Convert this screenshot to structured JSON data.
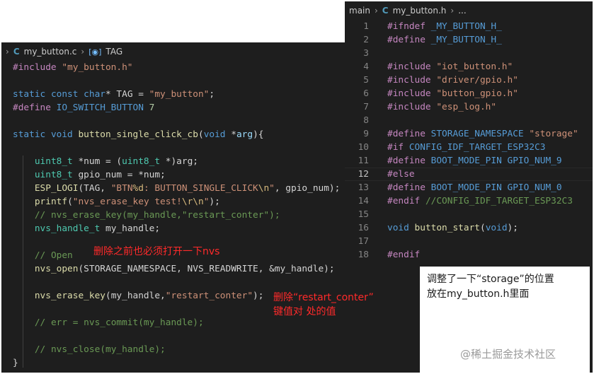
{
  "left_editor": {
    "breadcrumb": {
      "file": "my_button.c",
      "symbol": "TAG"
    },
    "lines": [
      [
        [
          "pp",
          "#include "
        ],
        [
          "str",
          "\"my_button.h\""
        ]
      ],
      [],
      [
        [
          "kw",
          "static "
        ],
        [
          "kw",
          "const "
        ],
        [
          "kw",
          "char"
        ],
        [
          "txt",
          "* TAG = "
        ],
        [
          "str",
          "\"my_button\""
        ],
        [
          "txt",
          ";"
        ]
      ],
      [
        [
          "pp",
          "#define "
        ],
        [
          "mac",
          "IO_SWITCH_BUTTON "
        ],
        [
          "num",
          "7"
        ]
      ],
      [],
      [
        [
          "kw",
          "static "
        ],
        [
          "kw",
          "void "
        ],
        [
          "fn",
          "button_single_click_cb"
        ],
        [
          "txt",
          "("
        ],
        [
          "kw",
          "void "
        ],
        [
          "txt",
          "*"
        ],
        [
          "var",
          "arg"
        ],
        [
          "txt",
          "){"
        ]
      ],
      [],
      [
        [
          "txt",
          "    "
        ],
        [
          "ty",
          "uint8_t "
        ],
        [
          "txt",
          "*num = ("
        ],
        [
          "ty",
          "uint8_t "
        ],
        [
          "txt",
          "*)arg;"
        ]
      ],
      [
        [
          "txt",
          "    "
        ],
        [
          "ty",
          "uint8_t "
        ],
        [
          "txt",
          "gpio_num = *num;"
        ]
      ],
      [
        [
          "txt",
          "    "
        ],
        [
          "fn",
          "ESP_LOGI"
        ],
        [
          "txt",
          "(TAG, "
        ],
        [
          "str",
          "\"BTN"
        ],
        [
          "fmt",
          "%d"
        ],
        [
          "str",
          ": BUTTON_SINGLE_CLICK"
        ],
        [
          "esc",
          "\\n"
        ],
        [
          "str",
          "\""
        ],
        [
          "txt",
          ", gpio_num);"
        ]
      ],
      [
        [
          "txt",
          "    "
        ],
        [
          "fn",
          "printf"
        ],
        [
          "txt",
          "("
        ],
        [
          "str",
          "\"nvs_erase_key test!"
        ],
        [
          "esc",
          "\\r\\n"
        ],
        [
          "str",
          "\""
        ],
        [
          "txt",
          ");"
        ]
      ],
      [
        [
          "txt",
          "    "
        ],
        [
          "cm",
          "// nvs_erase_key(my_handle,\"restart_conter\");"
        ]
      ],
      [
        [
          "txt",
          "    "
        ],
        [
          "ty",
          "nvs_handle_t "
        ],
        [
          "txt",
          "my_handle;"
        ]
      ],
      [],
      [
        [
          "txt",
          "    "
        ],
        [
          "cm",
          "// Open"
        ]
      ],
      [
        [
          "txt",
          "    "
        ],
        [
          "fn",
          "nvs_open"
        ],
        [
          "txt",
          "(STORAGE_NAMESPACE, NVS_READWRITE, &my_handle);"
        ]
      ],
      [],
      [
        [
          "txt",
          "    "
        ],
        [
          "fn",
          "nvs_erase_key"
        ],
        [
          "txt",
          "(my_handle,"
        ],
        [
          "str",
          "\"restart_conter\""
        ],
        [
          "txt",
          ");"
        ]
      ],
      [],
      [
        [
          "txt",
          "    "
        ],
        [
          "cm",
          "// err = nvs_commit(my_handle);"
        ]
      ],
      [],
      [
        [
          "txt",
          "    "
        ],
        [
          "cm",
          "// nvs_close(my_handle);"
        ]
      ],
      [
        [
          "txt",
          "}"
        ]
      ]
    ]
  },
  "right_editor": {
    "breadcrumb": {
      "folder": "main",
      "file": "my_button.h",
      "ellipsis": "..."
    },
    "active_line": 12,
    "lines": [
      {
        "n": "1",
        "t": [
          [
            "pp",
            "#ifndef "
          ],
          [
            "mac",
            "_MY_BUTTON_H_"
          ]
        ]
      },
      {
        "n": "2",
        "t": [
          [
            "pp",
            "#define "
          ],
          [
            "mac",
            "_MY_BUTTON_H_"
          ]
        ]
      },
      {
        "n": "3",
        "t": []
      },
      {
        "n": "4",
        "t": [
          [
            "pp",
            "#include "
          ],
          [
            "str",
            "\"iot_button.h\""
          ]
        ]
      },
      {
        "n": "5",
        "t": [
          [
            "pp",
            "#include "
          ],
          [
            "str",
            "\"driver/gpio.h\""
          ]
        ]
      },
      {
        "n": "6",
        "t": [
          [
            "pp",
            "#include "
          ],
          [
            "str",
            "\"button_gpio.h\""
          ]
        ]
      },
      {
        "n": "7",
        "t": [
          [
            "pp",
            "#include "
          ],
          [
            "str",
            "\"esp_log.h\""
          ]
        ]
      },
      {
        "n": "8",
        "t": []
      },
      {
        "n": "9",
        "t": [
          [
            "pp",
            "#define "
          ],
          [
            "mac",
            "STORAGE_NAMESPACE "
          ],
          [
            "str",
            "\"storage\""
          ]
        ]
      },
      {
        "n": "10",
        "t": [
          [
            "pp",
            "#if "
          ],
          [
            "mac",
            "CONFIG_IDF_TARGET_ESP32C3"
          ]
        ]
      },
      {
        "n": "11",
        "t": [
          [
            "pp",
            "#define "
          ],
          [
            "mac",
            "BOOT_MODE_PIN "
          ],
          [
            "mac",
            "GPIO_NUM_9"
          ]
        ]
      },
      {
        "n": "12",
        "t": [
          [
            "pp",
            "#else"
          ]
        ]
      },
      {
        "n": "13",
        "t": [
          [
            "pp",
            "#define "
          ],
          [
            "mac",
            "BOOT_MODE_PIN "
          ],
          [
            "mac",
            "GPIO_NUM_0"
          ]
        ]
      },
      {
        "n": "14",
        "t": [
          [
            "pp",
            "#endif "
          ],
          [
            "cm",
            "//CONFIG_IDF_TARGET_ESP32C3"
          ]
        ]
      },
      {
        "n": "15",
        "t": []
      },
      {
        "n": "16",
        "t": [
          [
            "kw",
            "void "
          ],
          [
            "fn",
            "button_start"
          ],
          [
            "txt",
            "("
          ],
          [
            "kw",
            "void"
          ],
          [
            "txt",
            ");"
          ]
        ]
      },
      {
        "n": "17",
        "t": []
      },
      {
        "n": "18",
        "t": [
          [
            "pp",
            "#endif"
          ]
        ]
      }
    ]
  },
  "annotations": {
    "open_note": "删除之前也必须打开一下nvs",
    "erase_note_line1": "删除“restart_conter”",
    "erase_note_line2": "键值对 处的值",
    "box_line1": "调整了一下“storage”的位置",
    "box_line2": "放在my_button.h里面"
  },
  "watermark": "@稀土掘金技术社区"
}
